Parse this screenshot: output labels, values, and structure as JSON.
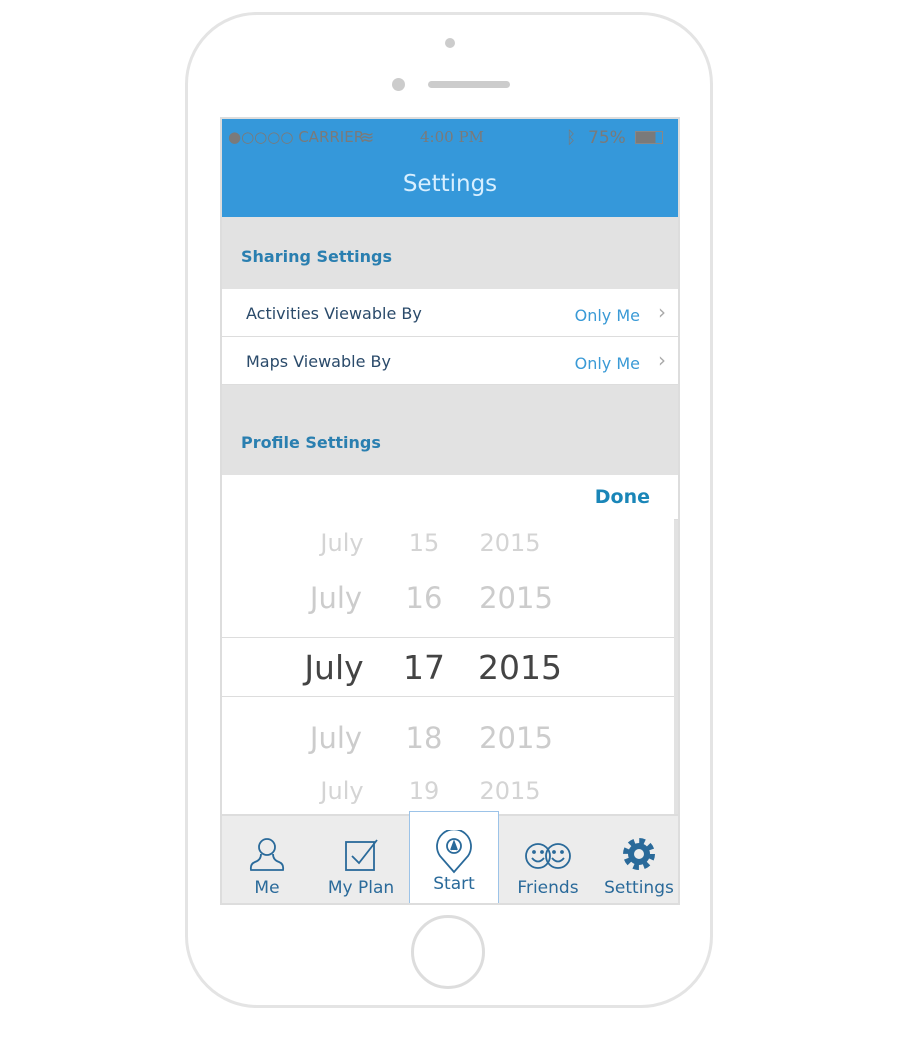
{
  "status": {
    "carrier": "●○○○○ CARRIER",
    "time": "4:00 PM",
    "battery": "75%"
  },
  "nav": {
    "title": "Settings"
  },
  "sharing": {
    "header": "Sharing Settings",
    "rows": [
      {
        "label": "Activities Viewable By",
        "value": "Only Me"
      },
      {
        "label": "Maps Viewable By",
        "value": "Only Me"
      }
    ]
  },
  "profile": {
    "header": "Profile Settings"
  },
  "picker": {
    "done": "Done",
    "rows": [
      {
        "month": "July",
        "day": "15",
        "year": "2015"
      },
      {
        "month": "July",
        "day": "16",
        "year": "2015"
      },
      {
        "month": "July",
        "day": "17",
        "year": "2015"
      },
      {
        "month": "July",
        "day": "18",
        "year": "2015"
      },
      {
        "month": "July",
        "day": "19",
        "year": "2015"
      }
    ],
    "selected_index": 2
  },
  "tabs": [
    {
      "label": "Me",
      "icon": "person-icon"
    },
    {
      "label": "My Plan",
      "icon": "checkbox-icon"
    },
    {
      "label": "Start",
      "icon": "location-pin-icon",
      "active": true
    },
    {
      "label": "Friends",
      "icon": "smiley-faces-icon"
    },
    {
      "label": "Settings",
      "icon": "gear-icon"
    }
  ],
  "colors": {
    "accent": "#3598da",
    "tab_text": "#2a6a9a"
  }
}
